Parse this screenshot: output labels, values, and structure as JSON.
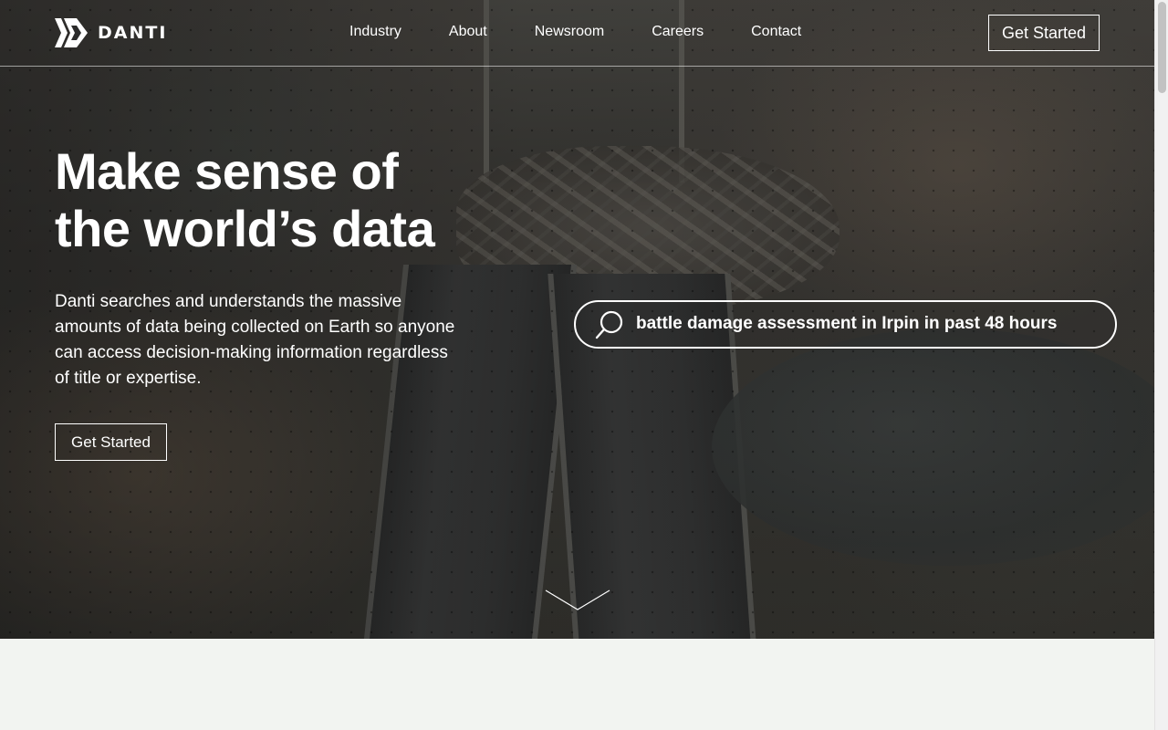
{
  "brand": {
    "name": "DANTI"
  },
  "nav": {
    "links": [
      "Industry",
      "About",
      "Newsroom",
      "Careers",
      "Contact"
    ],
    "cta_label": "Get Started"
  },
  "hero": {
    "headline_line1": "Make sense of",
    "headline_line2": "the world’s data",
    "description": "Danti searches and understands the massive amounts of data being collected on Earth so anyone can access decision-making information regardless of title or expertise.",
    "cta_label": "Get Started",
    "search_query": "battle damage assessment in Irpin in past 48 hours",
    "search_icon": "search-icon",
    "scroll_icon": "chevron-down-icon"
  },
  "colors": {
    "text": "#ffffff",
    "lower_background": "#f2f4f1"
  }
}
